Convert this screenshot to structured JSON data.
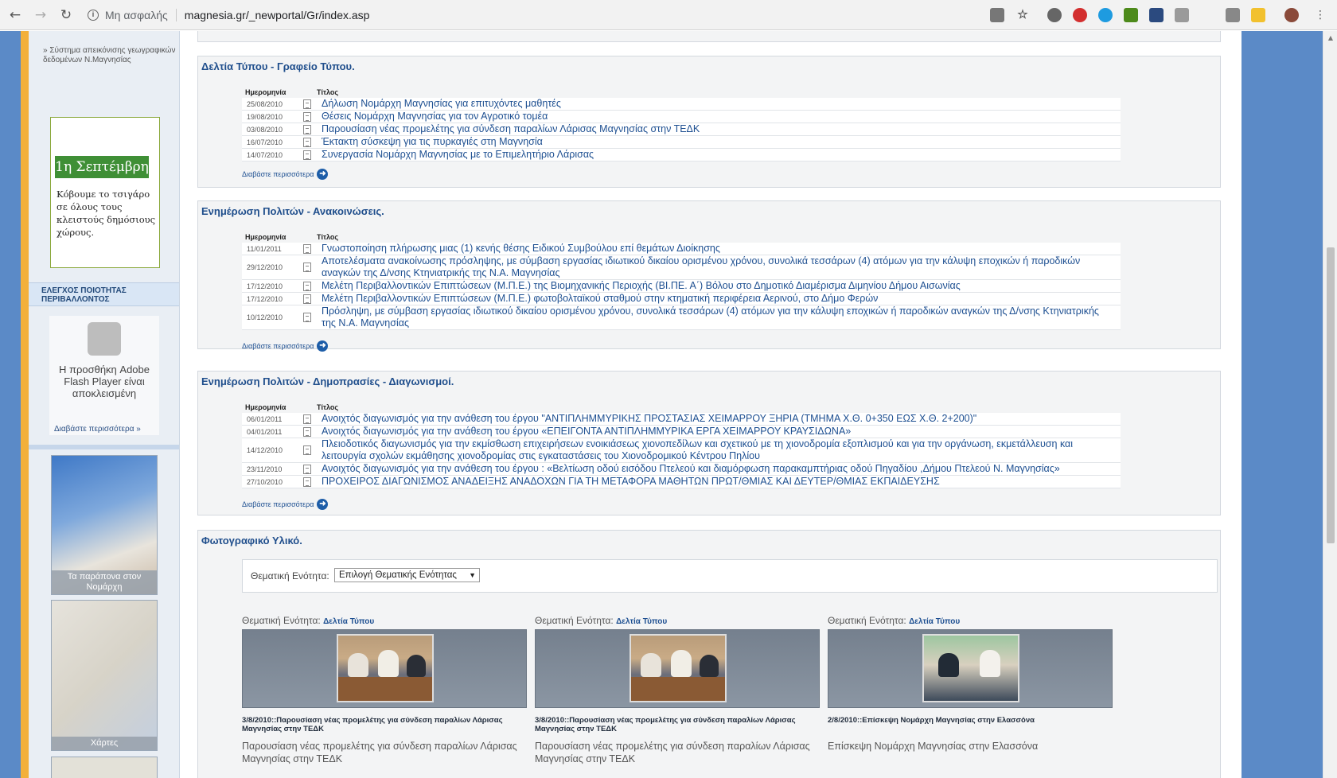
{
  "browser": {
    "insecure_label": "Μη ασφαλής",
    "url": "magnesia.gr/_newportal/Gr/index.asp",
    "info_icon": "i"
  },
  "sidebar": {
    "geo_link": "» Σύστημα απεικόνισης γεωγραφικών δεδομένων Ν.Μαγνησίας",
    "ad": {
      "date": "1η Σεπτέμβρη",
      "text": "Κόβουμε το τσιγάρο σε όλους τους κλειστούς δημόσιους χώρους."
    },
    "quality_heading": "ΕΛΕΓΧΟΣ ΠΟΙΟΤΗΤΑΣ ΠΕΡΙΒΑΛΛΟΝΤΟΣ",
    "flash_message": "Η προσθήκη Adobe Flash Player είναι αποκλεισμένη",
    "more_link": "Διαβάστε περισσότερα »",
    "tiles": [
      {
        "caption": "Τα παράπονα στον Νομάρχη"
      },
      {
        "caption": "Χάρτες"
      }
    ]
  },
  "columns": {
    "date": "Ημερομηνία",
    "title": "Τίτλος"
  },
  "more_label": "Διαβάστε περισσότερα",
  "press": {
    "title": "Δελτία Τύπου - Γραφείο Τύπου.",
    "rows": [
      {
        "date": "25/08/2010",
        "title": "Δήλωση Νομάρχη Μαγνησίας για επιτυχόντες μαθητές"
      },
      {
        "date": "19/08/2010",
        "title": "Θέσεις Νομάρχη Μαγνησίας για τον Αγροτικό τομέα"
      },
      {
        "date": "03/08/2010",
        "title": "Παρουσίαση νέας προμελέτης για σύνδεση παραλίων Λάρισας Μαγνησίας στην ΤΕΔΚ"
      },
      {
        "date": "16/07/2010",
        "title": "Έκτακτη σύσκεψη για τις πυρκαγιές στη Μαγνησία"
      },
      {
        "date": "14/07/2010",
        "title": "Συνεργασία Νομάρχη Μαγνησίας με το Επιμελητήριο Λάρισας"
      }
    ]
  },
  "announcements": {
    "title": "Ενημέρωση Πολιτών - Ανακοινώσεις.",
    "rows": [
      {
        "date": "11/01/2011",
        "title": "Γνωστοποίηση πλήρωσης μιας (1) κενής θέσης Ειδικού Συμβούλου επί θεμάτων Διοίκησης"
      },
      {
        "date": "29/12/2010",
        "title": "Αποτελέσματα ανακοίνωσης πρόσληψης, με σύμβαση εργασίας ιδιωτικού δικαίου ορισμένου χρόνου, συνολικά τεσσάρων (4) ατόμων για την κάλυψη εποχικών ή παροδικών αναγκών της Δ/νσης Κτηνιατρικής της Ν.Α. Μαγνησίας"
      },
      {
        "date": "17/12/2010",
        "title": "Μελέτη Περιβαλλοντικών Επιπτώσεων (Μ.Π.Ε.) της Βιομηχανικής Περιοχής (ΒΙ.ΠΕ. Α΄) Βόλου στο Δημοτικό Διαμέρισμα Διμηνίου Δήμου Αισωνίας"
      },
      {
        "date": "17/12/2010",
        "title": "Μελέτη Περιβαλλοντικών Επιπτώσεων (Μ.Π.Ε.) φωτοβολταϊκού σταθμού στην κτηματική περιφέρεια Αερινού, στο Δήμο Φερών"
      },
      {
        "date": "10/12/2010",
        "title": "Πρόσληψη, με σύμβαση εργασίας ιδιωτικού δικαίου ορισμένου χρόνου, συνολικά τεσσάρων (4) ατόμων για την κάλυψη εποχικών ή παροδικών αναγκών της Δ/νσης Κτηνιατρικής της Ν.Α. Μαγνησίας"
      }
    ]
  },
  "tenders": {
    "title": "Ενημέρωση Πολιτών - Δημοπρασίες - Διαγωνισμοί.",
    "rows": [
      {
        "date": "06/01/2011",
        "title": "Ανοιχτός διαγωνισμός για την ανάθεση του έργου \"ΑΝΤΙΠΛΗΜΜΥΡΙΚΗΣ ΠΡΟΣΤΑΣΙΑΣ ΧΕΙΜΑΡΡΟΥ ΞΗΡΙΑ (ΤΜΗΜΑ Χ.Θ. 0+350 ΕΩΣ Χ.Θ. 2+200)\""
      },
      {
        "date": "04/01/2011",
        "title": "Ανοιχτός διαγωνισμός για την ανάθεση του έργου «ΕΠΕΙΓΟΝΤΑ ΑΝΤΙΠΛΗΜΜΥΡΙΚΑ ΕΡΓΑ ΧΕΙΜΑΡΡΟΥ ΚΡΑΥΣΙΔΩΝΑ»"
      },
      {
        "date": "14/12/2010",
        "title": "Πλειοδοτικός διαγωνισμός για την εκμίσθωση επιχειρήσεων ενοικιάσεως χιονοπεδίλων και σχετικού με τη χιονοδρομία εξοπλισμού και για την οργάνωση, εκμετάλλευση και λειτουργία σχολών εκμάθησης χιονοδρομίας στις εγκαταστάσεις του Χιονοδρομικού Κέντρου Πηλίου"
      },
      {
        "date": "23/11/2010",
        "title": "Ανοιχτός διαγωνισμός για την ανάθεση του έργου : «Βελτίωση οδού εισόδου Πτελεού και διαμόρφωση παρακαμπτήριας οδού Πηγαδίου ,Δήμου Πτελεού Ν. Μαγνησίας»"
      },
      {
        "date": "27/10/2010",
        "title": "ΠΡΟΧΕΙΡΟΣ ΔΙΑΓΩΝΙΣΜΟΣ ΑΝΑΔΕΙΞΗΣ ΑΝΑΔΟΧΩΝ ΓΙΑ ΤΗ ΜΕΤΑΦΟΡΑ ΜΑΘΗΤΩΝ ΠΡΩΤ/ΘΜΙΑΣ ΚΑΙ ΔΕΥΤΕΡ/ΘΜΙΑΣ ΕΚΠΑΙΔΕΥΣΗΣ"
      }
    ]
  },
  "photos": {
    "title": "Φωτογραφικό Υλικό.",
    "filter_label": "Θεματική Ενότητα:",
    "filter_value": "Επιλογή Θεματικής Ενότητας",
    "category_label": "Θεματική Ενότητα:",
    "items": [
      {
        "category": "Δελτία Τύπου",
        "caption": "3/8/2010::Παρουσίαση νέας προμελέτης για σύνδεση παραλίων Λάρισας Μαγνησίας στην ΤΕΔΚ",
        "description": "Παρουσίαση νέας προμελέτης για σύνδεση παραλίων Λάρισας Μαγνησίας στην ΤΕΔΚ"
      },
      {
        "category": "Δελτία Τύπου",
        "caption": "3/8/2010::Παρουσίαση νέας προμελέτης για σύνδεση παραλίων Λάρισας Μαγνησίας στην ΤΕΔΚ",
        "description": "Παρουσίαση νέας προμελέτης για σύνδεση παραλίων Λάρισας Μαγνησίας στην ΤΕΔΚ"
      },
      {
        "category": "Δελτία Τύπου",
        "caption": "2/8/2010::Επίσκεψη Νομάρχη Μαγνησίας στην Ελασσόνα",
        "description": "Επίσκεψη Νομάρχη Μαγνησίας στην Ελασσόνα"
      }
    ]
  },
  "colors": {
    "accent": "#1d4f91",
    "sidebar_stripe": "#f3b03b",
    "frame_blue": "#5b8ac7"
  }
}
